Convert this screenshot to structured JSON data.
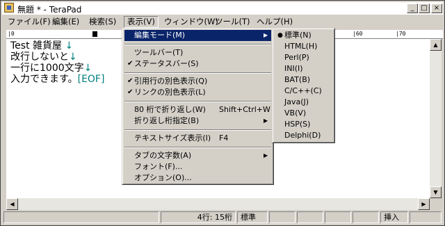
{
  "window": {
    "title": "無題 * - TeraPad",
    "minimize": "_",
    "maximize": "□",
    "close": "×"
  },
  "menubar": [
    {
      "label": "ファイル(F)"
    },
    {
      "label": "編集(E)"
    },
    {
      "label": "検索(S)"
    },
    {
      "label": "表示(V)",
      "active": true
    },
    {
      "label": "ウィンドウ(W)"
    },
    {
      "label": "ツール(T)"
    },
    {
      "label": "ヘルプ(H)"
    }
  ],
  "ruler": {
    "marks": [
      "|0",
      "|60",
      "|70"
    ]
  },
  "editor": {
    "lines": [
      {
        "text": "Test 雑貨屋 ",
        "eol": "↓"
      },
      {
        "text": "改行しないと",
        "eol": "↓"
      },
      {
        "text": "一行に1000文字",
        "eol": "↓"
      },
      {
        "text": "入力できます。",
        "eol": "[EOF]"
      }
    ]
  },
  "view_menu": {
    "items": [
      {
        "label": "編集モード(M)",
        "submenu": true,
        "highlighted": true
      },
      {
        "label": "ツールバー(T)"
      },
      {
        "label": "ステータスバー(S)",
        "checked": true
      },
      {
        "label": "引用行の別色表示(Q)",
        "checked": true
      },
      {
        "label": "リンクの別色表示(L)",
        "checked": true
      },
      {
        "label": "80 桁で折り返し(W)",
        "shortcut": "Shift+Ctrl+W"
      },
      {
        "label": "折り返し桁指定(B)",
        "submenu": true
      },
      {
        "label": "テキストサイズ表示(I)",
        "shortcut": "F4"
      },
      {
        "label": "タブの文字数(A)",
        "submenu": true
      },
      {
        "label": "フォント(F)..."
      },
      {
        "label": "オプション(O)..."
      }
    ]
  },
  "mode_submenu": {
    "items": [
      {
        "label": "標準(N)",
        "selected": true
      },
      {
        "label": "HTML(H)"
      },
      {
        "label": "Perl(P)"
      },
      {
        "label": "INI(I)"
      },
      {
        "label": "BAT(B)"
      },
      {
        "label": "C/C++(C)"
      },
      {
        "label": "Java(J)"
      },
      {
        "label": "VB(V)"
      },
      {
        "label": "HSP(S)"
      },
      {
        "label": "Delphi(D)"
      }
    ]
  },
  "status": {
    "position": "4行:  15桁",
    "mode": "標準",
    "insert": "挿入"
  },
  "icons": {
    "check": "✔",
    "radio": "●",
    "arrow": "▶",
    "scroll_up": "▲",
    "scroll_down": "▼",
    "scroll_left": "◀",
    "scroll_right": "▶"
  }
}
